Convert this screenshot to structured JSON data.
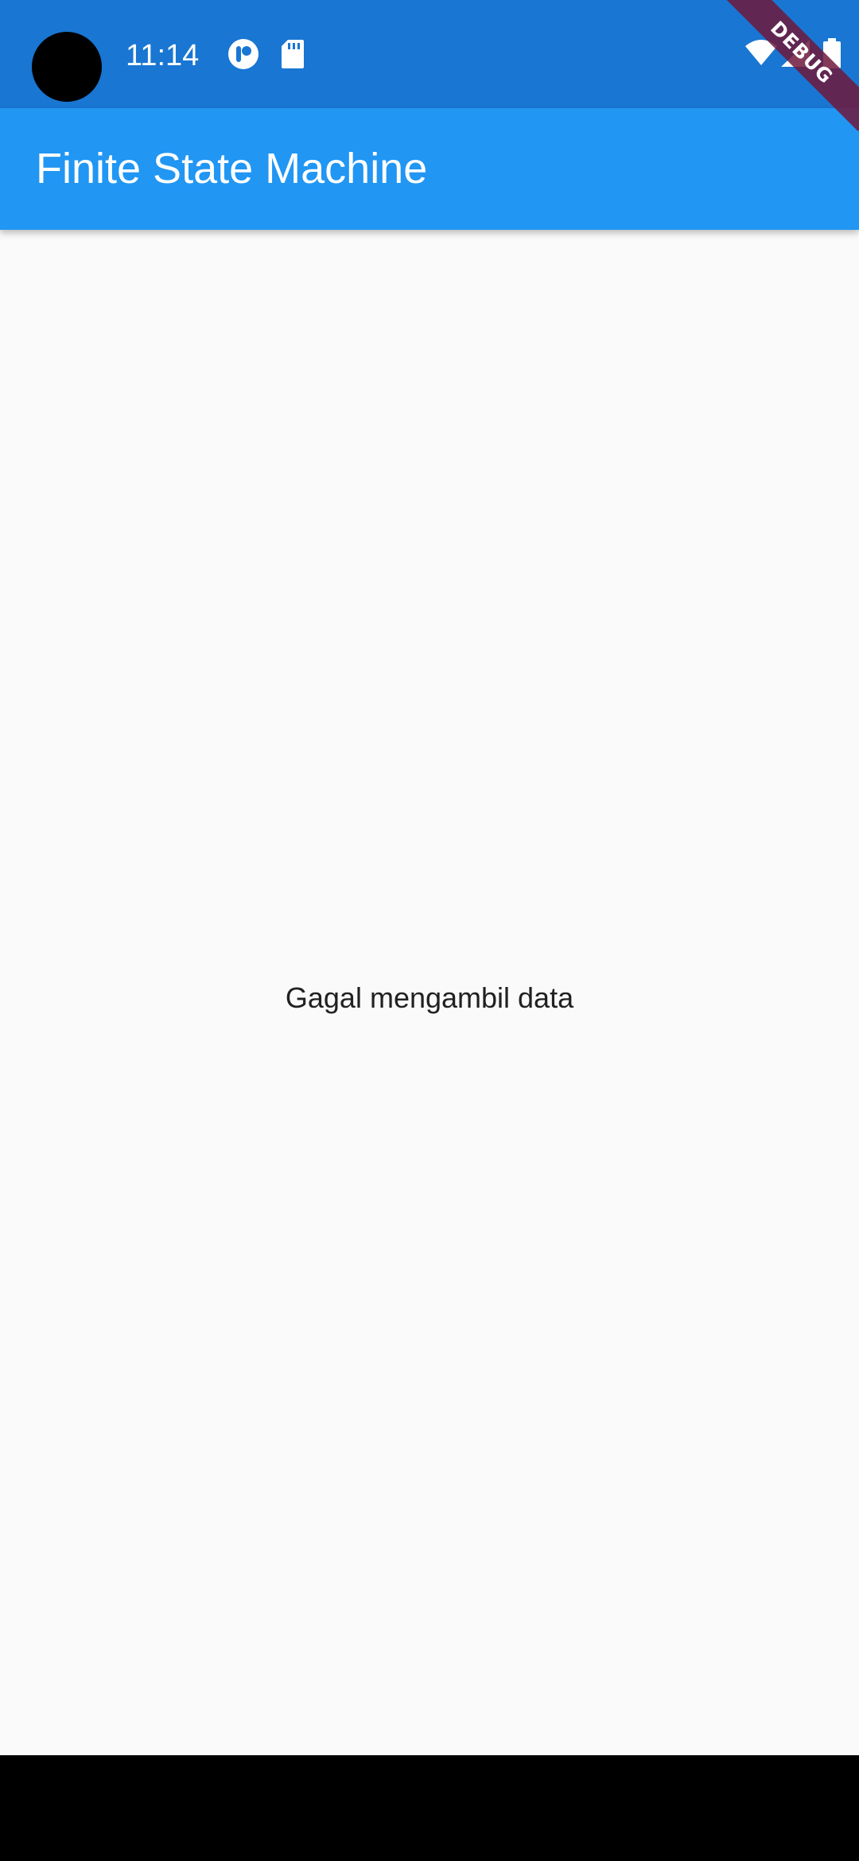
{
  "status_bar": {
    "time": "11:14",
    "icons": [
      "camera-cutout",
      "app-notification-icon",
      "sd-card-icon",
      "wifi-icon",
      "cell-signal-icon",
      "battery-icon"
    ],
    "background": "#1976d2"
  },
  "app_bar": {
    "title": "Finite State Machine",
    "background": "#2196f3"
  },
  "body": {
    "message": "Gagal mengambil data"
  },
  "debug_banner": {
    "label": "DEBUG"
  }
}
